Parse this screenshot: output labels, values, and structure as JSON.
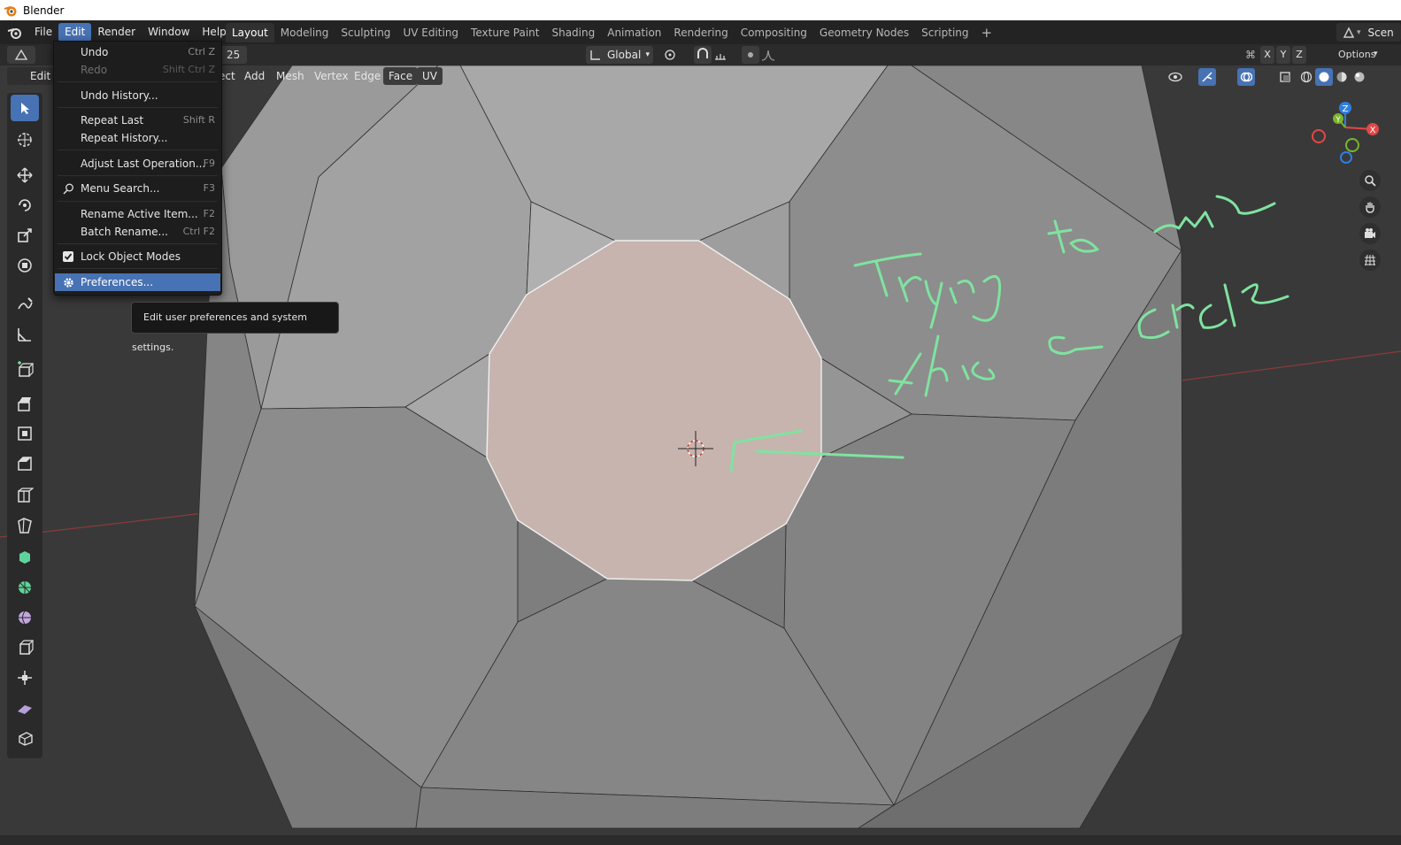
{
  "window": {
    "title": "Blender"
  },
  "menubar": {
    "items": [
      {
        "label": "File"
      },
      {
        "label": "Edit"
      },
      {
        "label": "Render"
      },
      {
        "label": "Window"
      },
      {
        "label": "Help"
      }
    ]
  },
  "workspaces": {
    "tabs": [
      {
        "label": "Layout"
      },
      {
        "label": "Modeling"
      },
      {
        "label": "Sculpting"
      },
      {
        "label": "UV Editing"
      },
      {
        "label": "Texture Paint"
      },
      {
        "label": "Shading"
      },
      {
        "label": "Animation"
      },
      {
        "label": "Rendering"
      },
      {
        "label": "Compositing"
      },
      {
        "label": "Geometry Nodes"
      },
      {
        "label": "Scripting"
      }
    ],
    "add_label": "+",
    "scene_label": "Scen"
  },
  "header": {
    "orientation": "Global",
    "axes": [
      "X",
      "Y",
      "Z"
    ],
    "options": "Options",
    "mode_partial": "Edit M",
    "field_partial": "25"
  },
  "viewport_menu": {
    "items": [
      {
        "label": "ect"
      },
      {
        "label": "Add"
      },
      {
        "label": "Mesh"
      },
      {
        "label": "Vertex"
      },
      {
        "label": "Edge"
      },
      {
        "label": "Face"
      },
      {
        "label": "UV"
      }
    ]
  },
  "edit_menu": {
    "items": [
      {
        "label": "Undo",
        "shortcut": "Ctrl Z",
        "enabled": true
      },
      {
        "label": "Redo",
        "shortcut": "Shift Ctrl Z",
        "enabled": false
      },
      {
        "label": "Undo History...",
        "shortcut": "",
        "enabled": true
      },
      {
        "label": "Repeat Last",
        "shortcut": "Shift R",
        "enabled": true
      },
      {
        "label": "Repeat History...",
        "shortcut": "",
        "enabled": true
      },
      {
        "label": "Adjust Last Operation...",
        "shortcut": "F9",
        "enabled": true
      },
      {
        "label": "Menu Search...",
        "shortcut": "F3",
        "enabled": true
      },
      {
        "label": "Rename Active Item...",
        "shortcut": "F2",
        "enabled": true
      },
      {
        "label": "Batch Rename...",
        "shortcut": "Ctrl F2",
        "enabled": true
      },
      {
        "label": "Lock Object Modes",
        "shortcut": "",
        "enabled": true,
        "checked": true
      },
      {
        "label": "Preferences...",
        "shortcut": "",
        "enabled": true,
        "highlighted": true
      }
    ]
  },
  "tooltip": {
    "text": "Edit user preferences and system settings."
  },
  "annotation": {
    "text": "Trying to make this a circle"
  },
  "colors": {
    "accent": "#4772b3",
    "annotation": "#7fe3a0",
    "face_selected": "#c7b4ae"
  }
}
